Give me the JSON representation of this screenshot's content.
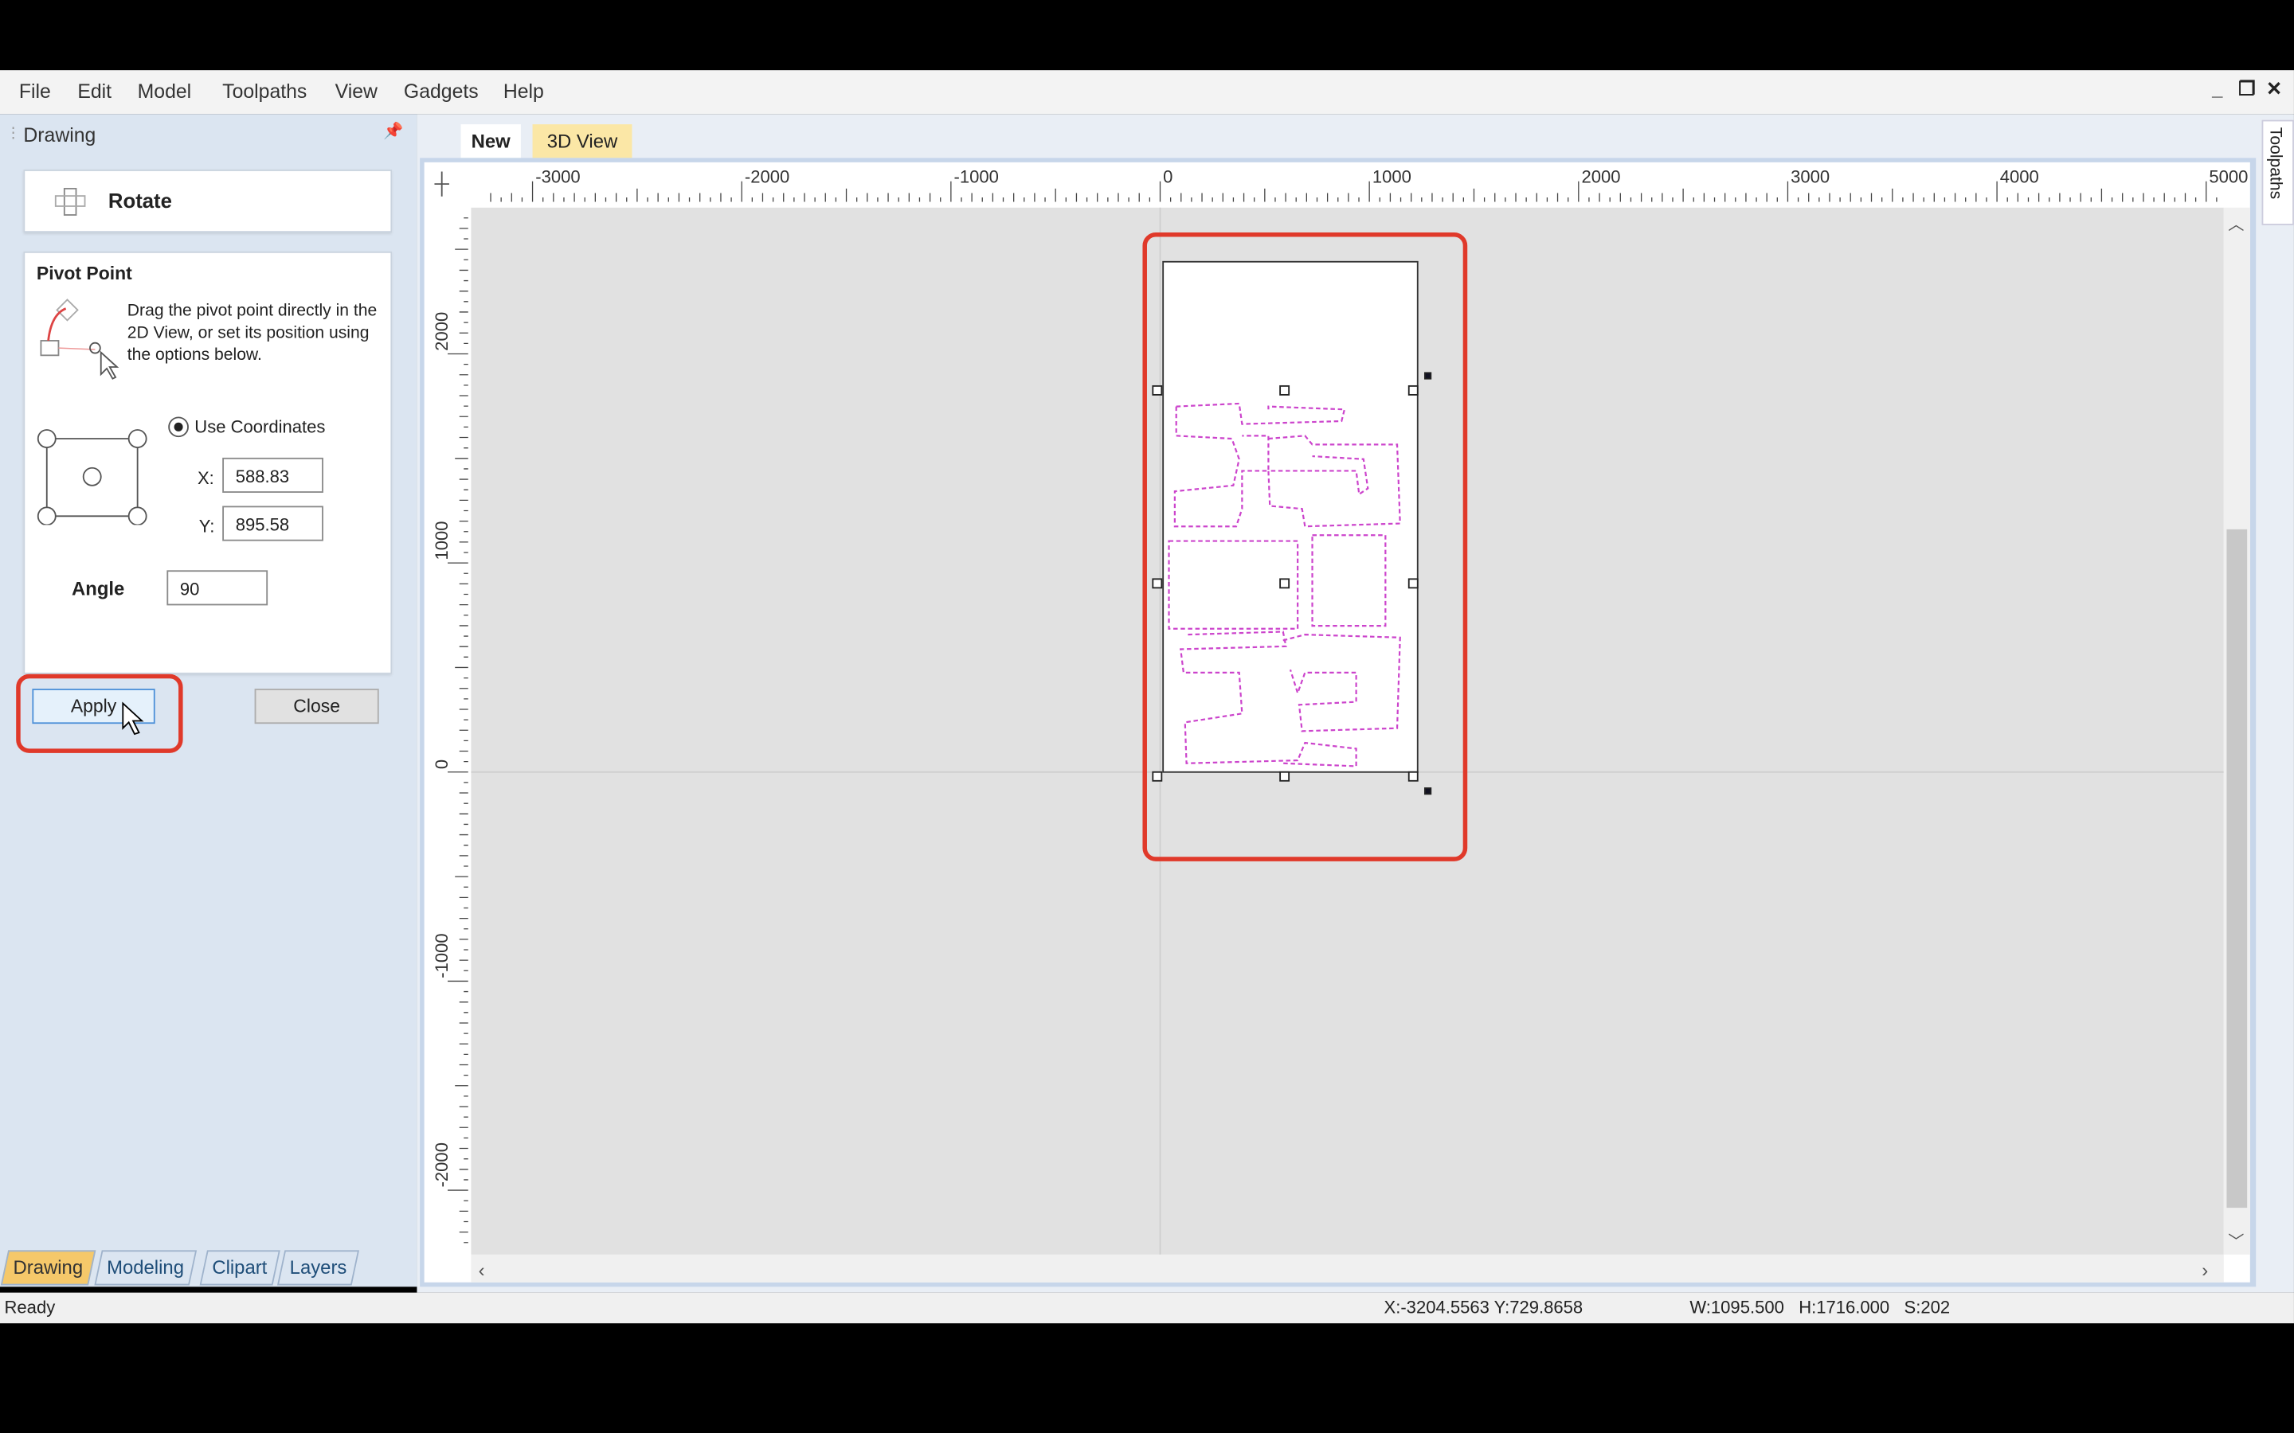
{
  "menu": [
    "File",
    "Edit",
    "Model",
    "Toolpaths",
    "View",
    "Gadgets",
    "Help"
  ],
  "window_controls": {
    "minimize": "_",
    "restore": "❐",
    "close": "✕"
  },
  "left_panel": {
    "title": "Drawing",
    "tool_title": "Rotate",
    "pivot": {
      "heading": "Pivot Point",
      "description": "Drag the pivot point directly in the 2D View, or set its position using the options below.",
      "use_coordinates_label": "Use Coordinates",
      "use_coordinates_checked": true,
      "x_label": "X:",
      "x_value": "588.83",
      "y_label": "Y:",
      "y_value": "895.58"
    },
    "angle_label": "Angle",
    "angle_value": "90",
    "apply_label": "Apply",
    "close_label": "Close",
    "bottom_tabs": [
      "Drawing",
      "Modeling",
      "Clipart",
      "Layers"
    ]
  },
  "view_tabs": [
    "New",
    "3D View"
  ],
  "right_tab": "Toolpaths",
  "ruler": {
    "x_labels": [
      "-3000",
      "-2000",
      "-1000",
      "0",
      "1000",
      "2000",
      "3000",
      "4000",
      "5000"
    ],
    "y_labels": [
      "2000",
      "1000",
      "0",
      "-1000",
      "-2000"
    ]
  },
  "colors": {
    "highlight": "#e0392a",
    "vectors": "#cc44cc",
    "panel": "#dbe5f1",
    "canvas": "#e1e1e1"
  },
  "status": {
    "left": "Ready",
    "coords": "X:-3204.5563 Y:729.8658",
    "size": "W:1095.500   H:1716.000   S:202"
  }
}
